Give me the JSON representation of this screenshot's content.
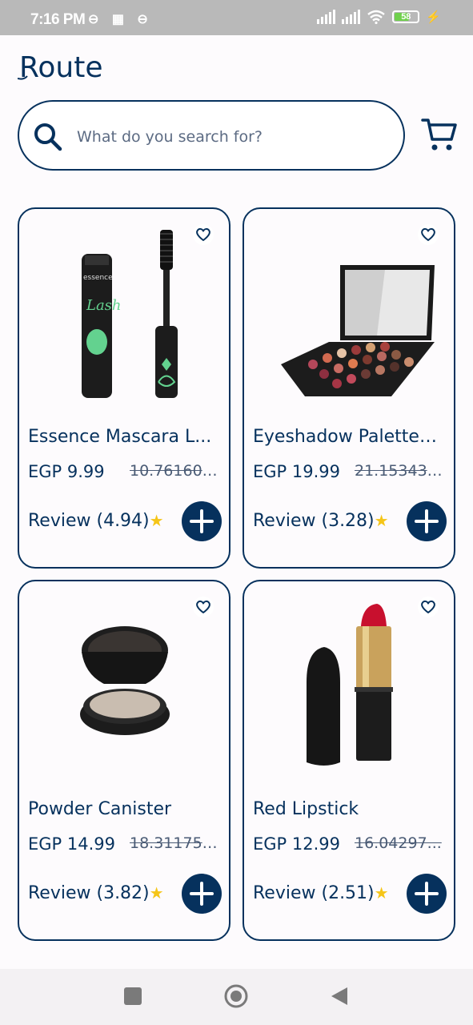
{
  "status_bar": {
    "time": "7:16 PM",
    "small_icons": "⊖ ▦ ⊖",
    "battery": "58"
  },
  "header": {
    "logo_text": "Route"
  },
  "search": {
    "placeholder": "What do you search for?"
  },
  "colors": {
    "primary": "#06315d",
    "star": "#f5c518",
    "background": "#fdfbfd"
  },
  "products": [
    {
      "name": "Essence Mascara L...",
      "price": "EGP 9.99",
      "old_price": "10.761607...",
      "review": "Review (4.94)",
      "image_icon": "mascara-image"
    },
    {
      "name": "Eyeshadow Palette ...",
      "price": "EGP 19.99",
      "old_price": "21.153439...",
      "review": "Review (3.28)",
      "image_icon": "eyeshadow-palette-image"
    },
    {
      "name": "Powder Canister",
      "price": "EGP 14.99",
      "old_price": "18.3117517...",
      "review": "Review (3.82)",
      "image_icon": "powder-canister-image"
    },
    {
      "name": "Red Lipstick",
      "price": "EGP 12.99",
      "old_price": "16.04297...",
      "review": "Review (2.51)",
      "image_icon": "lipstick-image"
    }
  ]
}
